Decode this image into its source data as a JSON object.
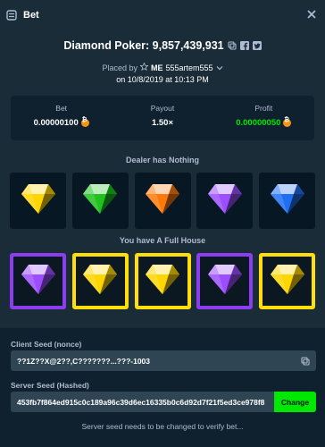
{
  "header": {
    "title": "Bet",
    "bet_icon": "bet-slip-icon",
    "close_icon": "close-icon"
  },
  "game": {
    "title": "Diamond Poker: 9,857,439,931",
    "icons": [
      "copy-icon",
      "facebook-icon",
      "twitter-icon"
    ]
  },
  "placed": {
    "prefix": "Placed by",
    "user": "ME",
    "handle": "555artem555",
    "date": "on 10/8/2019 at 10:13 PM"
  },
  "stats": {
    "bet_label": "Bet",
    "bet_value": "0.00000100",
    "payout_label": "Payout",
    "payout_value": "1.50×",
    "profit_label": "Profit",
    "profit_value": "0.00000050",
    "currency_icon": "bitcoin-icon"
  },
  "dealer": {
    "label": "Dealer has Nothing",
    "gems": [
      "yellow",
      "green",
      "orange",
      "purple",
      "blue"
    ]
  },
  "player": {
    "label": "You have A Full House",
    "gems": [
      "purple",
      "yellow",
      "yellow",
      "purple",
      "yellow"
    ],
    "highlights": [
      "purple",
      "yellow",
      "yellow",
      "purple",
      "yellow"
    ]
  },
  "colors": {
    "yellow": "#ffd500",
    "green": "#1fc21f",
    "orange": "#ff7a0a",
    "purple": "#9b4dff",
    "blue": "#1f6ff2"
  },
  "seeds": {
    "client_label": "Client Seed (nonce)",
    "client_value": "??1Z??X@2??,C???????...???-1003",
    "server_label": "Server Seed (Hashed)",
    "server_value": "453fb7f864ed915c0c189a96c39d6ec16335b0c6d92d7f21f5ed3ce978f8",
    "change_label": "Change",
    "note": "Server seed needs to be changed to verify bet..."
  }
}
